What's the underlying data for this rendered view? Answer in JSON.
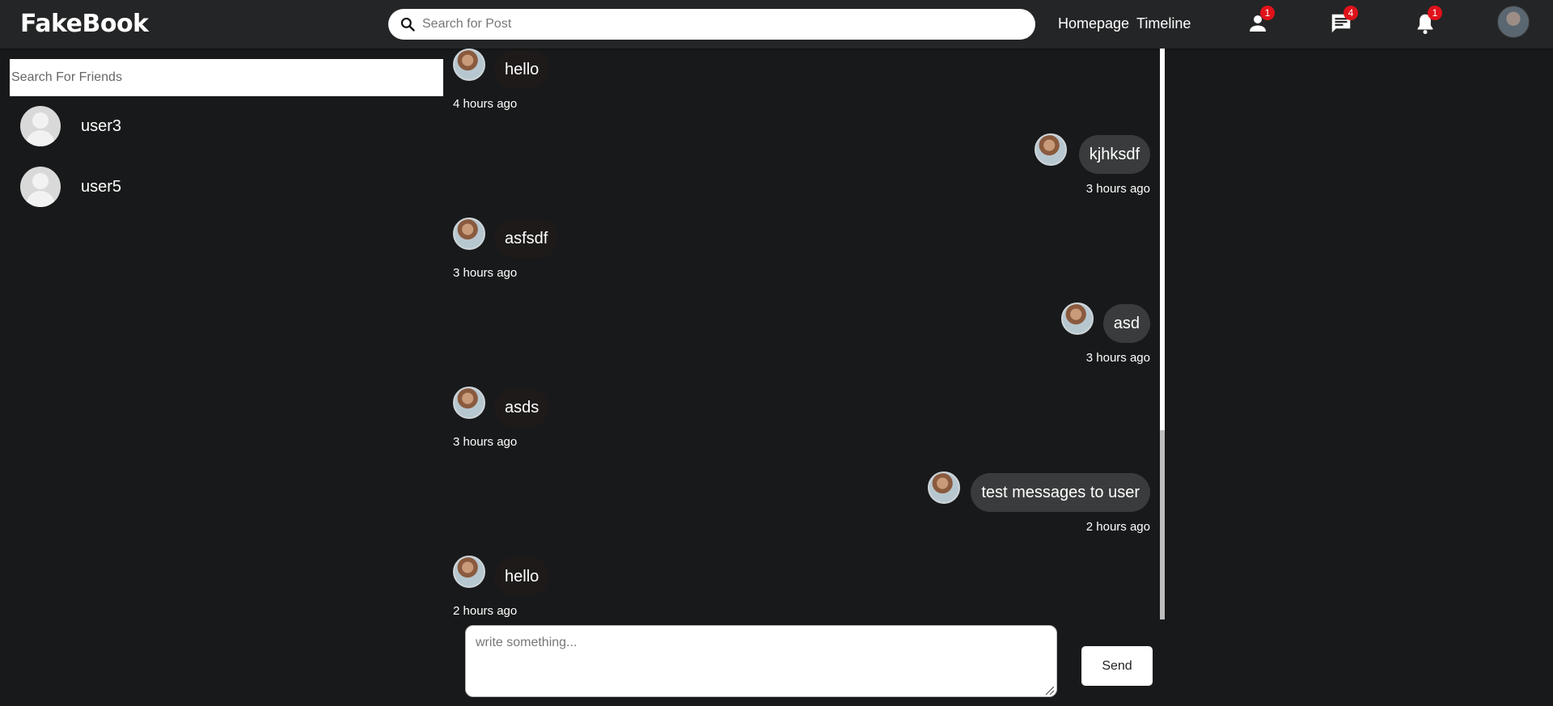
{
  "app": {
    "logo": "FakeBook"
  },
  "topbar": {
    "search_placeholder": "Search for Post",
    "links": [
      "Homepage",
      "Timeline"
    ],
    "badges": {
      "friends": "1",
      "messages": "4",
      "notifications": "1"
    },
    "icons": [
      "person-icon",
      "chat-icon",
      "bell-icon",
      "search-icon"
    ]
  },
  "sidebar": {
    "search_placeholder": "Search For Friends",
    "friends": [
      {
        "name": "user3"
      },
      {
        "name": "user5"
      }
    ]
  },
  "messages": [
    {
      "direction": "in",
      "text": "hello",
      "time": "4 hours ago"
    },
    {
      "direction": "out",
      "text": "kjhksdf",
      "time": "3 hours ago"
    },
    {
      "direction": "in",
      "text": "asfsdf",
      "time": "3 hours ago"
    },
    {
      "direction": "out",
      "text": "asd",
      "time": "3 hours ago"
    },
    {
      "direction": "in",
      "text": "asds",
      "time": "3 hours ago"
    },
    {
      "direction": "out",
      "text": "test messages to user",
      "time": "2 hours ago"
    },
    {
      "direction": "in",
      "text": "hello",
      "time": "2 hours ago"
    }
  ],
  "composer": {
    "placeholder": "write something...",
    "value": "",
    "send_label": "Send"
  },
  "colors": {
    "background": "#18191a",
    "topbar": "#242526",
    "badge": "#e0121a",
    "outgoing_bubble": "#3a3b3c"
  }
}
